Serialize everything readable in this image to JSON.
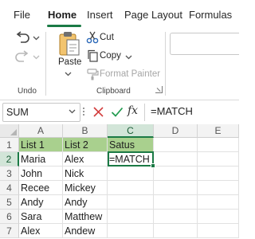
{
  "menu": {
    "tabs": [
      {
        "label": "File"
      },
      {
        "label": "Home"
      },
      {
        "label": "Insert"
      },
      {
        "label": "Page Layout"
      },
      {
        "label": "Formulas"
      }
    ],
    "active_tab": "Home"
  },
  "ribbon": {
    "undo_group_label": "Undo",
    "clipboard_group_label": "Clipboard",
    "paste_label": "Paste",
    "cut_label": "Cut",
    "copy_label": "Copy",
    "format_painter_label": "Format Painter",
    "icons": [
      "undo-icon",
      "redo-icon",
      "chevron-down-icon",
      "paste-icon",
      "scissors-icon",
      "copy-icon",
      "format-painter-icon",
      "dialog-launcher-icon"
    ]
  },
  "formula_bar": {
    "name_box": "SUM",
    "cancel_icon": "x-icon",
    "enter_icon": "check-icon",
    "fx_label": "fx",
    "formula": "=MATCH"
  },
  "grid": {
    "columns": [
      "A",
      "B",
      "C",
      "D",
      "E"
    ],
    "selected_column": "C",
    "row_numbers": [
      "1",
      "2",
      "3",
      "4",
      "5",
      "6",
      "7"
    ],
    "selected_row": "2",
    "header_fill": "#a9d08e",
    "accent_color": "#1b7a45",
    "rows": [
      [
        "List 1",
        "List 2",
        "Satus"
      ],
      [
        "Maria",
        "Alex",
        "=MATCH"
      ],
      [
        "John",
        "Nick",
        ""
      ],
      [
        "Recee",
        "Mickey",
        ""
      ],
      [
        "Andy",
        "Andy",
        ""
      ],
      [
        "Sara",
        "Matthew",
        ""
      ],
      [
        "Alex",
        "Andew",
        ""
      ]
    ]
  }
}
